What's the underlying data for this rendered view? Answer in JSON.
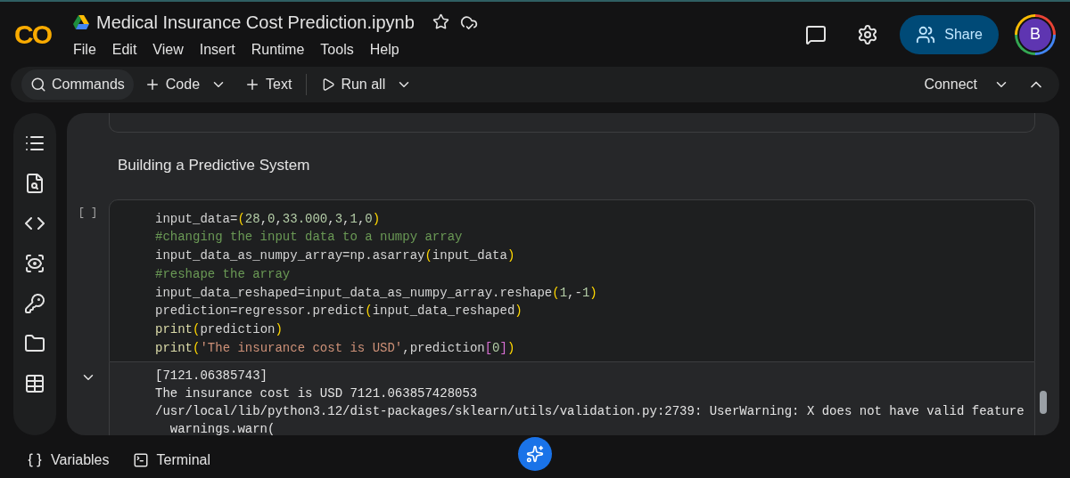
{
  "logo": "CO",
  "notebook": {
    "title": "Medical Insurance Cost Prediction.ipynb"
  },
  "menu": [
    "File",
    "Edit",
    "View",
    "Insert",
    "Runtime",
    "Tools",
    "Help"
  ],
  "share": "Share",
  "avatar": "B",
  "toolbar": {
    "items": [
      {
        "label": "Commands",
        "kind": "search",
        "dropdown": false
      },
      {
        "label": "Code",
        "kind": "add",
        "dropdown": true
      },
      {
        "label": "Text",
        "kind": "add",
        "dropdown": false
      },
      {
        "label": "Run all",
        "kind": "run",
        "dropdown": true
      }
    ],
    "connect": "Connect"
  },
  "heading": "Building a Predictive System",
  "cell": {
    "execution_count": "[ ]",
    "output_expanded": true,
    "lines": [
      [
        {
          "t": "input_data=",
          "kind": "plain"
        },
        {
          "t": "(",
          "kind": "paren"
        },
        {
          "t": "28",
          "kind": "number"
        },
        {
          "t": ",",
          "kind": "plain"
        },
        {
          "t": "0",
          "kind": "number"
        },
        {
          "t": ",",
          "kind": "plain"
        },
        {
          "t": "33.000",
          "kind": "number"
        },
        {
          "t": ",",
          "kind": "plain"
        },
        {
          "t": "3",
          "kind": "number"
        },
        {
          "t": ",",
          "kind": "plain"
        },
        {
          "t": "1",
          "kind": "number"
        },
        {
          "t": ",",
          "kind": "plain"
        },
        {
          "t": "0",
          "kind": "number"
        },
        {
          "t": ")",
          "kind": "paren"
        }
      ],
      [
        {
          "t": "#changing the input data to a numpy array",
          "kind": "comment"
        }
      ],
      [
        {
          "t": "input_data_as_numpy_array=np.asarray",
          "kind": "plain"
        },
        {
          "t": "(",
          "kind": "paren"
        },
        {
          "t": "input_data",
          "kind": "plain"
        },
        {
          "t": ")",
          "kind": "paren"
        }
      ],
      [
        {
          "t": "#reshape the array",
          "kind": "comment"
        }
      ],
      [
        {
          "t": "input_data_reshaped=input_data_as_numpy_array.reshape",
          "kind": "plain"
        },
        {
          "t": "(",
          "kind": "paren"
        },
        {
          "t": "1",
          "kind": "number"
        },
        {
          "t": ",-",
          "kind": "plain"
        },
        {
          "t": "1",
          "kind": "number"
        },
        {
          "t": ")",
          "kind": "paren"
        }
      ],
      [
        {
          "t": "prediction=regressor.predict",
          "kind": "plain"
        },
        {
          "t": "(",
          "kind": "paren"
        },
        {
          "t": "input_data_reshaped",
          "kind": "plain"
        },
        {
          "t": ")",
          "kind": "paren"
        }
      ],
      [
        {
          "t": "print",
          "kind": "builtin"
        },
        {
          "t": "(",
          "kind": "paren"
        },
        {
          "t": "prediction",
          "kind": "plain"
        },
        {
          "t": ")",
          "kind": "paren"
        }
      ],
      [
        {
          "t": "print",
          "kind": "builtin"
        },
        {
          "t": "(",
          "kind": "paren"
        },
        {
          "t": "'The insurance cost is USD'",
          "kind": "string"
        },
        {
          "t": ",prediction",
          "kind": "plain"
        },
        {
          "t": "[",
          "kind": "bracket"
        },
        {
          "t": "0",
          "kind": "number"
        },
        {
          "t": "]",
          "kind": "bracket"
        },
        {
          "t": ")",
          "kind": "paren"
        }
      ]
    ],
    "output": [
      "[7121.06385743]",
      "The insurance cost is USD 7121.063857428053",
      "/usr/local/lib/python3.12/dist-packages/sklearn/utils/validation.py:2739: UserWarning: X does not have valid feature",
      "  warnings.warn("
    ]
  },
  "bottom": [
    {
      "label": "Variables",
      "kind": "variables"
    },
    {
      "label": "Terminal",
      "kind": "terminal"
    }
  ]
}
